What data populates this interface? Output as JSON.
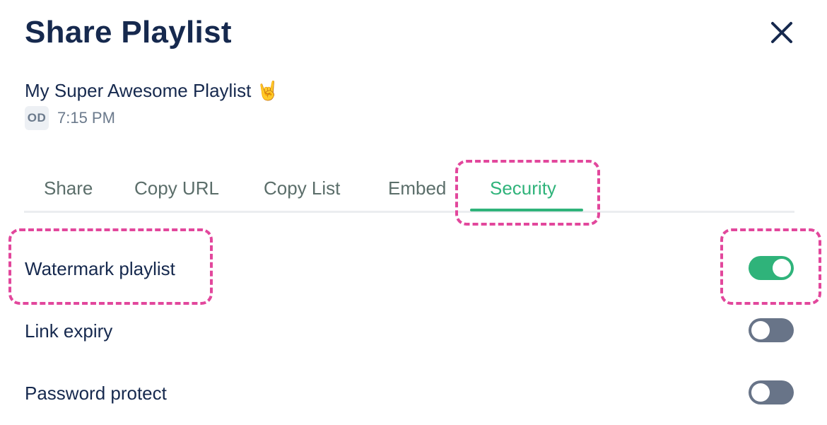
{
  "dialog": {
    "title": "Share Playlist",
    "close_icon": "close-icon"
  },
  "playlist": {
    "name": "My Super Awesome Playlist 🤘",
    "owner_initials": "OD",
    "time": "7:15 PM"
  },
  "tabs": [
    {
      "label": "Share",
      "active": false
    },
    {
      "label": "Copy URL",
      "active": false
    },
    {
      "label": "Copy List",
      "active": false
    },
    {
      "label": "Embed",
      "active": false
    },
    {
      "label": "Security",
      "active": true
    }
  ],
  "settings": [
    {
      "label": "Watermark playlist",
      "enabled": true
    },
    {
      "label": "Link expiry",
      "enabled": false
    },
    {
      "label": "Password protect",
      "enabled": false
    }
  ],
  "colors": {
    "accent": "#2fb37a",
    "annotation": "#e2479c",
    "toggle_off": "#687488",
    "title": "#16294e"
  }
}
